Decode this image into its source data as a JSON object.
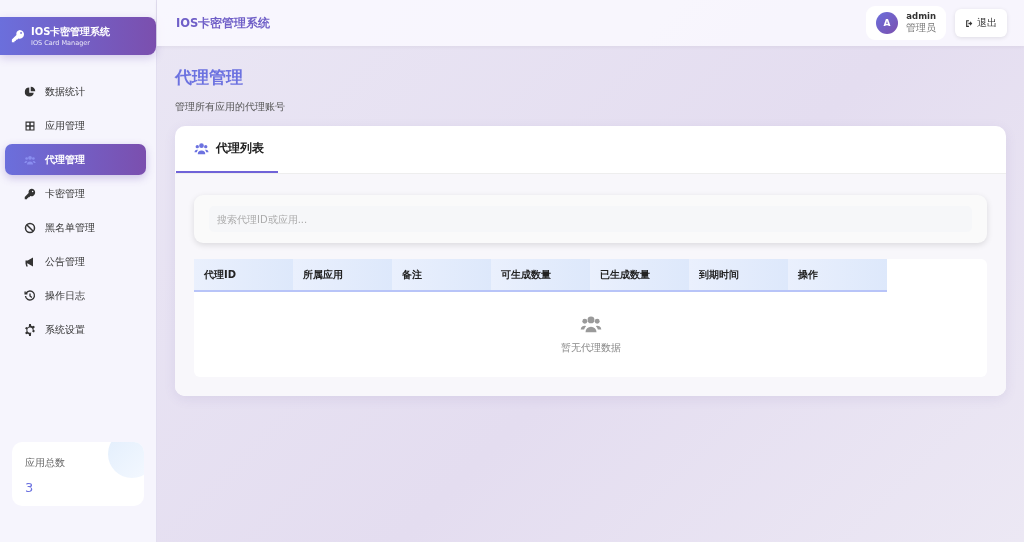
{
  "brand": {
    "title": "IOS卡密管理系统",
    "subtitle": "IOS Card Manager"
  },
  "sidebar": {
    "items": [
      {
        "label": "数据统计",
        "selected": false
      },
      {
        "label": "应用管理",
        "selected": false
      },
      {
        "label": "代理管理",
        "selected": true
      },
      {
        "label": "卡密管理",
        "selected": false
      },
      {
        "label": "黑名单管理",
        "selected": false
      },
      {
        "label": "公告管理",
        "selected": false
      },
      {
        "label": "操作日志",
        "selected": false
      },
      {
        "label": "系统设置",
        "selected": false
      }
    ],
    "stat": {
      "label": "应用总数",
      "value": "3"
    }
  },
  "topbar": {
    "title": "IOS卡密管理系统",
    "user": {
      "initial": "A",
      "name": "admin",
      "role": "管理员"
    },
    "logout": "退出"
  },
  "page": {
    "title": "代理管理",
    "subtitle": "管理所有应用的代理账号"
  },
  "panel": {
    "tab": "代理列表",
    "search": {
      "placeholder": "搜索代理ID或应用..."
    },
    "table": {
      "columns": [
        "代理ID",
        "所属应用",
        "备注",
        "可生成数量",
        "已生成数量",
        "到期时间",
        "操作"
      ],
      "empty": "暂无代理数据"
    }
  }
}
